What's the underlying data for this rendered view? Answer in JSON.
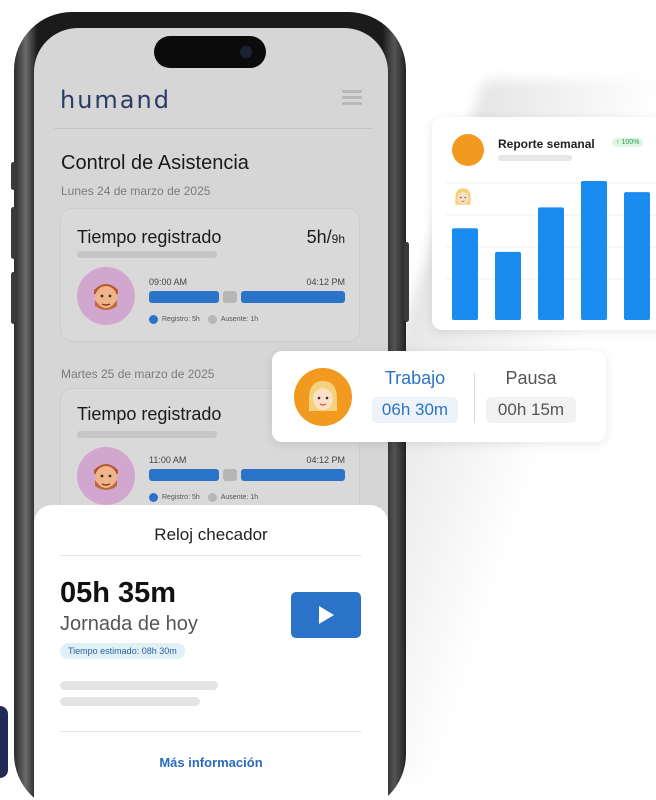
{
  "app": {
    "logo": "humand"
  },
  "attendance": {
    "title": "Control de Asistencia",
    "days": [
      {
        "date": "Lunes 24 de marzo de 2025",
        "card_title": "Tiempo registrado",
        "hours": "5h/",
        "hours_total": "9h",
        "start": "09:00 AM",
        "end": "04:12 PM",
        "legend_registro": "Registro: 5h",
        "legend_ausente": "Ausente: 1h"
      },
      {
        "date": "Martes 25 de marzo de 2025",
        "card_title": "Tiempo registrado",
        "start": "11:00 AM",
        "end": "04:12 PM",
        "legend_registro": "Registro: 5h",
        "legend_ausente": "Ausente: 1h"
      }
    ]
  },
  "clock": {
    "title": "Reloj checador",
    "time": "05h 35m",
    "label": "Jornada de hoy",
    "estimate": "Tiempo estimado: 08h 30m",
    "more": "Más información"
  },
  "report": {
    "title": "Reporte semanal",
    "badge": "↑ 100%",
    "bar_values": [
      0.66,
      0.49,
      0.81,
      1.0,
      0.92
    ]
  },
  "status": {
    "work_label": "Trabajo",
    "work_value": "06h 30m",
    "pause_label": "Pausa",
    "pause_value": "00h 15m"
  },
  "colors": {
    "accent": "#2b73c8",
    "brand": "#2a3b66",
    "chart_bar": "#1a8cf0",
    "avatar_orange": "#f29a1f",
    "avatar_pink": "#d2a7cf",
    "positive": "#2e9e4a"
  }
}
